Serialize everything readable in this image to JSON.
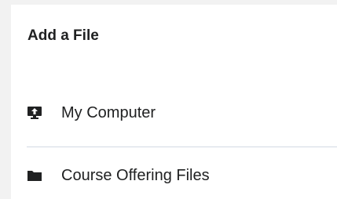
{
  "dialog": {
    "title": "Add a File"
  },
  "sources": [
    {
      "label": "My Computer",
      "icon": "computer-upload-icon"
    },
    {
      "label": "Course Offering Files",
      "icon": "folder-icon"
    }
  ],
  "colors": {
    "text": "#202122",
    "icon": "#202122",
    "divider": "#d3d9e3",
    "page_background": "#f2f2f2",
    "panel_background": "#ffffff"
  }
}
